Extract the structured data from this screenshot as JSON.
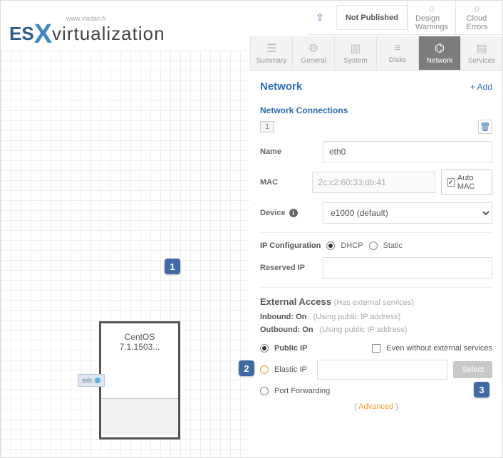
{
  "branding": {
    "url": "www.vladan.fr",
    "logo_es": "ES",
    "logo_x": "X",
    "logo_rest": "virtualization"
  },
  "topbar": {
    "not_published": "Not Published",
    "design_warnings": {
      "count": "0",
      "label": "Design\nWarnings"
    },
    "cloud_errors": {
      "count": "0",
      "label": "Cloud\nErrors"
    }
  },
  "tabs": {
    "summary": "Summary",
    "general": "General",
    "system": "System",
    "disks": "Disks",
    "network": "Network",
    "services": "Services"
  },
  "panel": {
    "title": "Network",
    "add": "+ Add"
  },
  "connections": {
    "title": "Network Connections",
    "tab_index": "1"
  },
  "form": {
    "name_label": "Name",
    "name_value": "eth0",
    "mac_label": "MAC",
    "mac_value": "2c:c2:60:33:db:41",
    "auto_mac": "Auto MAC",
    "device_label": "Device",
    "device_value": "e1000 (default)",
    "ipconf_label": "IP Configuration",
    "dhcp": "DHCP",
    "static": "Static",
    "reserved_label": "Reserved IP",
    "reserved_value": ""
  },
  "external": {
    "title": "External Access",
    "hint": "(Has external services)",
    "inbound_label": "Inbound:",
    "inbound_state": "On",
    "inbound_hint": "(Using public IP address)",
    "outbound_label": "Outbound:",
    "outbound_state": "On",
    "outbound_hint": "(Using public IP address)",
    "public_ip": "Public IP",
    "even_without": "Even without external services",
    "elastic_ip": "Elastic IP",
    "select_btn": "Select",
    "port_fwd": "Port Forwarding",
    "advanced": "Advanced"
  },
  "vm": {
    "line1": "CentOS",
    "line2": "7.1.1503...",
    "ssh": "ssh"
  },
  "steps": {
    "s1": "1",
    "s2": "2",
    "s3": "3"
  }
}
